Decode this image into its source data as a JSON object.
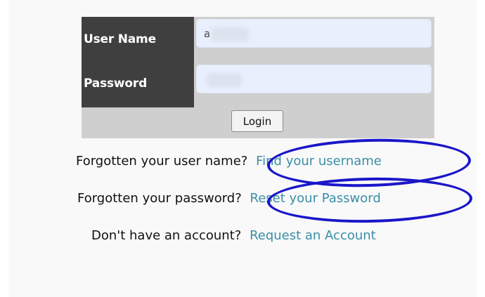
{
  "login_form": {
    "username_label": "User Name",
    "password_label": "Password",
    "username_value": "a",
    "password_value": "",
    "login_button_label": "Login"
  },
  "help_links": {
    "username_prompt": "Forgotten your user name?",
    "username_link": "Find your username",
    "password_prompt": "Forgotten your password?",
    "password_link": "Reset your Password",
    "account_prompt": "Don't have an account?",
    "account_link": "Request an Account"
  },
  "annotations": {
    "color": "#1a16c9",
    "highlighted": [
      "Find your username",
      "Reset your Password"
    ]
  }
}
